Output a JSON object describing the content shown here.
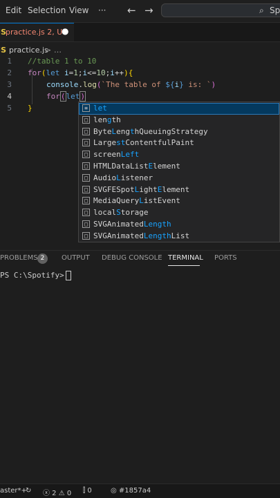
{
  "menu": {
    "edit": "Edit",
    "selection": "Selection",
    "view": "View",
    "more": "···"
  },
  "nav": {
    "back": "←",
    "forward": "→"
  },
  "search": {
    "text": "Spo"
  },
  "tab": {
    "icon": "JS",
    "label": "practice.js 2, U",
    "dirty": "●"
  },
  "breadcrumb": {
    "icon": "JS",
    "file": "practice.js",
    "sep": ">",
    "more": "…"
  },
  "editor": {
    "line_numbers": [
      "1",
      "2",
      "3",
      "4",
      "5"
    ],
    "code_typed": "for(let"
  },
  "suggestions": [
    {
      "icon": "≡",
      "kind": "keyword-icon",
      "parts": [
        {
          "t": "let",
          "h": true
        }
      ]
    },
    {
      "icon": "□",
      "kind": "property-icon",
      "parts": [
        {
          "t": "len",
          "h": false
        },
        {
          "t": "g",
          "h": true
        },
        {
          "t": "th",
          "h": false
        }
      ]
    },
    {
      "icon": "□",
      "kind": "variable-icon",
      "parts": [
        {
          "t": "Byte",
          "h": false
        },
        {
          "t": "L",
          "h": true
        },
        {
          "t": "eng",
          "h": false
        },
        {
          "t": "t",
          "h": true
        },
        {
          "t": "hQueuingStrategy",
          "h": false
        }
      ]
    },
    {
      "icon": "□",
      "kind": "variable-icon",
      "parts": [
        {
          "t": "Large",
          "h": false
        },
        {
          "t": "st",
          "h": true
        },
        {
          "t": "ContentfulPaint",
          "h": false
        }
      ]
    },
    {
      "icon": "□",
      "kind": "variable-icon",
      "parts": [
        {
          "t": "screen",
          "h": false
        },
        {
          "t": "Left",
          "h": true
        }
      ]
    },
    {
      "icon": "□",
      "kind": "variable-icon",
      "parts": [
        {
          "t": "HTMLDataList",
          "h": false
        },
        {
          "t": "E",
          "h": true
        },
        {
          "t": "lement",
          "h": false
        }
      ]
    },
    {
      "icon": "□",
      "kind": "variable-icon",
      "parts": [
        {
          "t": "Audio",
          "h": false
        },
        {
          "t": "L",
          "h": true
        },
        {
          "t": "istener",
          "h": false
        }
      ]
    },
    {
      "icon": "□",
      "kind": "variable-icon",
      "parts": [
        {
          "t": "SVGFESpot",
          "h": false
        },
        {
          "t": "L",
          "h": true
        },
        {
          "t": "ight",
          "h": false
        },
        {
          "t": "E",
          "h": true
        },
        {
          "t": "lement",
          "h": false
        }
      ]
    },
    {
      "icon": "□",
      "kind": "variable-icon",
      "parts": [
        {
          "t": "MediaQuery",
          "h": false
        },
        {
          "t": "L",
          "h": true
        },
        {
          "t": "istEvent",
          "h": false
        }
      ]
    },
    {
      "icon": "□",
      "kind": "variable-icon",
      "parts": [
        {
          "t": "local",
          "h": false
        },
        {
          "t": "S",
          "h": true
        },
        {
          "t": "torage",
          "h": false
        }
      ]
    },
    {
      "icon": "□",
      "kind": "variable-icon",
      "parts": [
        {
          "t": "SVGAnimated",
          "h": false
        },
        {
          "t": "Length",
          "h": true
        }
      ]
    },
    {
      "icon": "□",
      "kind": "variable-icon",
      "parts": [
        {
          "t": "SVGAnimated",
          "h": false
        },
        {
          "t": "Length",
          "h": true
        },
        {
          "t": "List",
          "h": false
        }
      ]
    }
  ],
  "panel": {
    "problems": "PROBLEMS",
    "problems_count": "2",
    "output": "OUTPUT",
    "debug": "DEBUG CONSOLE",
    "terminal": "TERMINAL",
    "ports": "PORTS"
  },
  "terminal": {
    "prompt": "PS C:\\Spotify>"
  },
  "status": {
    "branch": "aster*+",
    "sync": "↻",
    "errors": "ⓧ 2 ⚠ 0",
    "ports": "⫿ 0",
    "commit": "◎ #1857a4"
  }
}
